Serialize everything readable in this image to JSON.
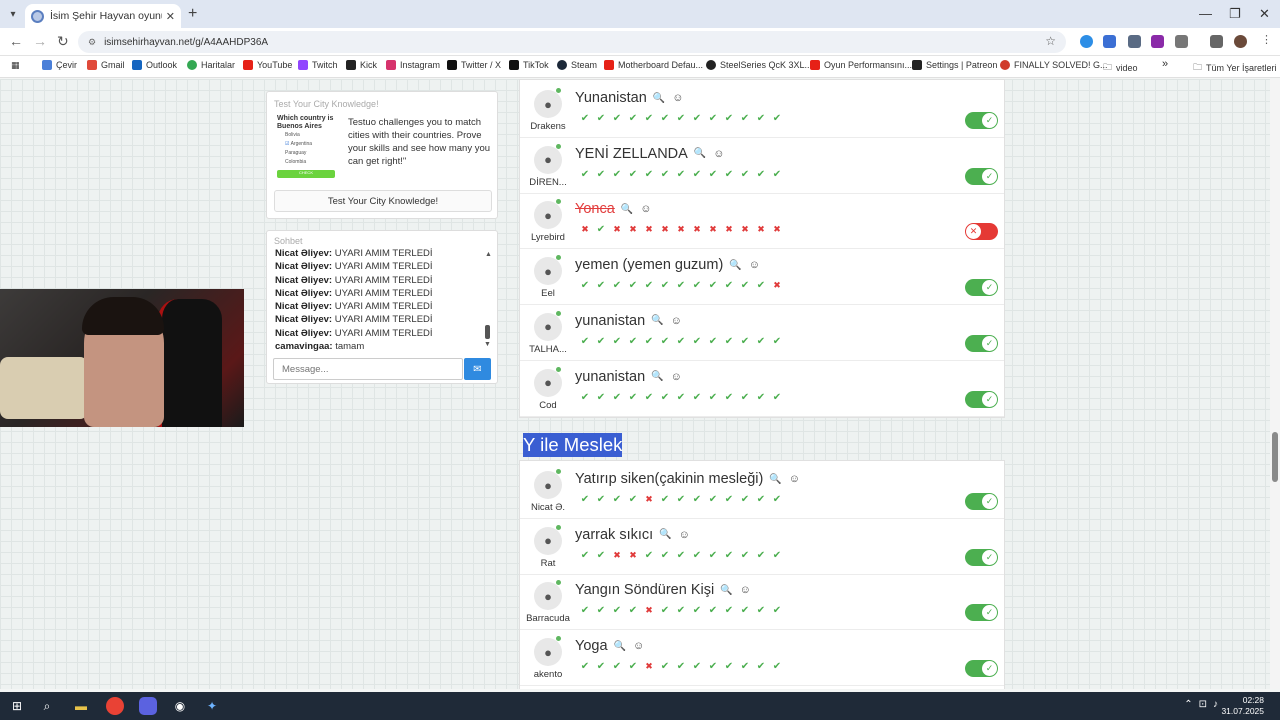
{
  "browser": {
    "tab_title": "İsim Şehir Hayvan oyununa katıl",
    "new_tab": "+",
    "url": "isimsehirhayvan.net/g/A4AAHDP36A",
    "bookmarks": [
      "Çevir",
      "Gmail",
      "Outlook",
      "Haritalar",
      "YouTube",
      "Twitch",
      "Kick",
      "Instagram",
      "Twitter / X",
      "TikTok",
      "Steam",
      "Motherboard Defau...",
      "SteelSeries QcK 3XL...",
      "Oyun Performansını...",
      "Settings | Patreon",
      "FINALLY SOLVED! G...",
      "video"
    ],
    "bookmark_more": "»",
    "all_bookmarks": "Tüm Yer İşaretleri"
  },
  "ad": {
    "header": "Test Your City Knowledge!",
    "question": "Which country is Buenos Aires",
    "options": [
      "Bolivia",
      "Argentina",
      "Paraguay",
      "Colombia"
    ],
    "img_button": "CHECK",
    "description": "Testuo challenges you to match cities with their countries. Prove your skills and see how many you can get right!\"",
    "button": "Test Your City Knowledge!"
  },
  "chat": {
    "header": "Sohbet",
    "messages": [
      {
        "user": "Nicat Əliyev:",
        "text": " UYARI AMIM TERLEDİ"
      },
      {
        "user": "Nicat Əliyev:",
        "text": " UYARI AMIM TERLEDİ"
      },
      {
        "user": "Nicat Əliyev:",
        "text": " UYARI AMIM TERLEDİ"
      },
      {
        "user": "Nicat Əliyev:",
        "text": " UYARI AMIM TERLEDİ"
      },
      {
        "user": "Nicat Əliyev:",
        "text": " UYARI AMIM TERLEDİ"
      },
      {
        "user": "Nicat Əliyev:",
        "text": " UYARI AMIM TERLEDİ"
      },
      {
        "user": "Nicat Əliyev:",
        "text": " UYARI AMIM TERLEDİ"
      },
      {
        "user": "camavingaa:",
        "text": " tamam"
      }
    ],
    "placeholder": "Message..."
  },
  "country_answers": [
    {
      "user": "Drakens",
      "answer": "Yunanistan",
      "votes": "yyyyyyyyyyyyy",
      "valid": true
    },
    {
      "user": "DİREN...",
      "answer": "YENİ ZELLANDA",
      "votes": "yyyyyyyyyyyyy",
      "valid": true
    },
    {
      "user": "Lyrebird",
      "answer": "Yonca",
      "votes": "nynnnnnnnnnnn",
      "valid": false
    },
    {
      "user": "Eel",
      "answer": "yemen (yemen guzum)",
      "votes": "yyyyyyyyyyyyn",
      "valid": true
    },
    {
      "user": "TALHA...",
      "answer": "yunanistan",
      "votes": "yyyyyyyyyyyyy",
      "valid": true
    },
    {
      "user": "Cod",
      "answer": "yunanistan",
      "votes": "yyyyyyyyyyyyy",
      "valid": true
    }
  ],
  "section_title": "Y ile Meslek",
  "job_answers": [
    {
      "user": "Nicat Ə.",
      "answer": "Yatırıp siken(çakinin mesleği)",
      "votes": "yyyynyyyyyyyy",
      "valid": true
    },
    {
      "user": "Rat",
      "answer": "yarrak sıkıcı",
      "votes": "yynnyyyyyyyyy",
      "valid": true
    },
    {
      "user": "Barracuda",
      "answer": "Yangın Söndüren Kişi",
      "votes": "yyyynyyyyyyyy",
      "valid": true
    },
    {
      "user": "akento",
      "answer": "Yoga",
      "votes": "yyyynyyyyyyyy",
      "valid": true
    }
  ],
  "taskbar": {
    "time": "02:28",
    "date": "31.07.2025"
  },
  "colors": {
    "accent": "#4caf50",
    "reject": "#e53935",
    "highlight": "#3a5ed2",
    "send": "#2f8ae0"
  }
}
